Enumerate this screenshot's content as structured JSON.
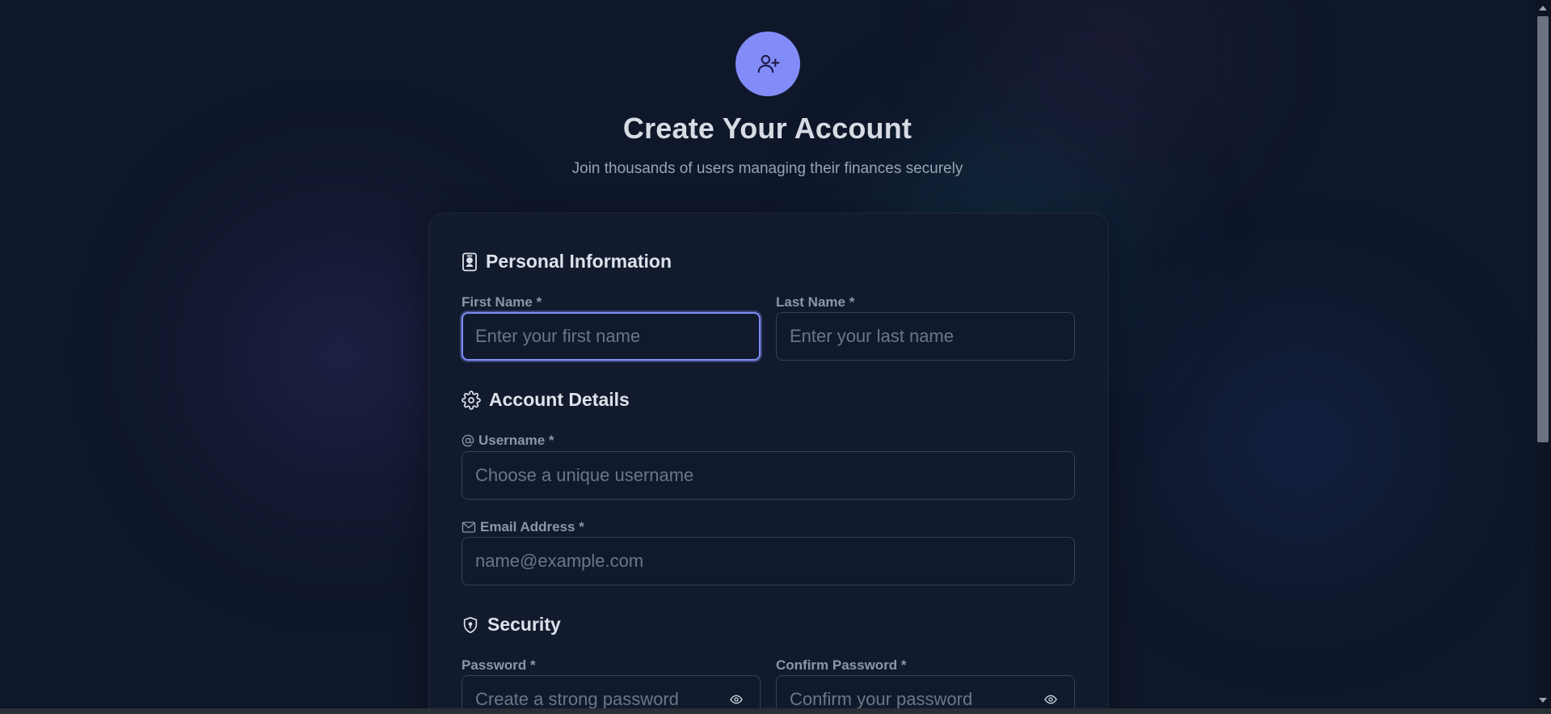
{
  "colors": {
    "accent": "#818cf8",
    "background": "#0f172a",
    "card": "#121b2e",
    "input_border": "#334155"
  },
  "header": {
    "icon": "user-plus-icon",
    "title": "Create Your Account",
    "subtitle": "Join thousands of users managing their finances securely"
  },
  "sections": {
    "personal": {
      "icon": "id-badge-icon",
      "title": "Personal Information",
      "first_name": {
        "label": "First Name *",
        "placeholder": "Enter your first name",
        "value": ""
      },
      "last_name": {
        "label": "Last Name *",
        "placeholder": "Enter your last name",
        "value": ""
      }
    },
    "account": {
      "icon": "gear-icon",
      "title": "Account Details",
      "username": {
        "icon": "at-icon",
        "label": "Username *",
        "placeholder": "Choose a unique username",
        "value": ""
      },
      "email": {
        "icon": "envelope-icon",
        "label": "Email Address *",
        "placeholder": "name@example.com",
        "value": ""
      }
    },
    "security": {
      "icon": "shield-icon",
      "title": "Security",
      "password": {
        "label": "Password *",
        "placeholder": "Create a strong password",
        "toggle_icon": "eye-icon"
      },
      "confirm_password": {
        "label": "Confirm Password *",
        "placeholder": "Confirm your password",
        "toggle_icon": "eye-icon"
      }
    }
  }
}
